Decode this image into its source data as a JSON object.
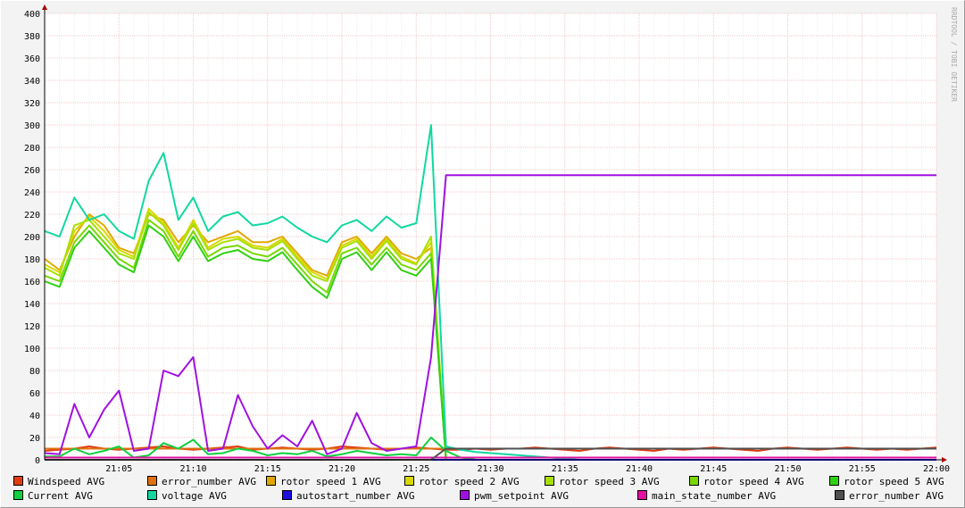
{
  "chart_data": {
    "type": "line",
    "watermark": "RRDTOOL / TOBI OETIKER",
    "ylim": [
      0,
      400
    ],
    "yticks": [
      0,
      20,
      40,
      60,
      80,
      100,
      120,
      140,
      160,
      180,
      200,
      220,
      240,
      260,
      280,
      300,
      320,
      340,
      360,
      380,
      400
    ],
    "x_minutes": [
      0,
      60
    ],
    "xticks": [
      {
        "m": 5,
        "label": "21:05"
      },
      {
        "m": 10,
        "label": "21:10"
      },
      {
        "m": 15,
        "label": "21:15"
      },
      {
        "m": 20,
        "label": "21:20"
      },
      {
        "m": 25,
        "label": "21:25"
      },
      {
        "m": 30,
        "label": "21:30"
      },
      {
        "m": 35,
        "label": "21:35"
      },
      {
        "m": 40,
        "label": "21:40"
      },
      {
        "m": 45,
        "label": "21:45"
      },
      {
        "m": 50,
        "label": "21:50"
      },
      {
        "m": 55,
        "label": "21:55"
      },
      {
        "m": 60,
        "label": "22:00"
      }
    ],
    "series": [
      {
        "name": "Windspeed AVG",
        "color": "#e03c10",
        "values": [
          8,
          9,
          10,
          12,
          10,
          9,
          10,
          11,
          12,
          10,
          9,
          10,
          11,
          12,
          9,
          10,
          11,
          10,
          9,
          10,
          12,
          11,
          10,
          9,
          10,
          11,
          10,
          9,
          9,
          10,
          9,
          10,
          10,
          11,
          10,
          9,
          8,
          10,
          11,
          10,
          9,
          8,
          10,
          9,
          10,
          11,
          10,
          9,
          8,
          10,
          11,
          10,
          9,
          10,
          11,
          10,
          9,
          10,
          9,
          10,
          11
        ]
      },
      {
        "name": "error_number AVG",
        "color": "#e07010",
        "values": [
          10,
          10,
          10,
          10,
          10,
          10,
          10,
          10,
          10,
          10,
          10,
          10,
          10,
          10,
          10,
          10,
          10,
          10,
          10,
          10,
          10,
          10,
          10,
          10,
          10,
          10,
          10,
          10,
          10,
          10,
          10,
          10,
          10,
          10,
          10,
          10,
          10,
          10,
          10,
          10,
          10,
          10,
          10,
          10,
          10,
          10,
          10,
          10,
          10,
          10,
          10,
          10,
          10,
          10,
          10,
          10,
          10,
          10,
          10,
          10,
          10
        ]
      },
      {
        "name": "rotor speed 1 AVG",
        "color": "#e0a800",
        "values": [
          180,
          170,
          200,
          220,
          210,
          190,
          185,
          220,
          215,
          195,
          210,
          195,
          200,
          205,
          195,
          195,
          200,
          185,
          170,
          165,
          195,
          200,
          185,
          200,
          185,
          180,
          190,
          0,
          0,
          0,
          0,
          0,
          0,
          0,
          0,
          0,
          0,
          0,
          0,
          0,
          0,
          0,
          0,
          0,
          0,
          0,
          0,
          0,
          0,
          0,
          0,
          0,
          0,
          0,
          0,
          0,
          0,
          0,
          0,
          0,
          0
        ]
      },
      {
        "name": "rotor speed 2 AVG",
        "color": "#d8d800",
        "values": [
          175,
          168,
          205,
          218,
          205,
          188,
          182,
          225,
          212,
          190,
          215,
          190,
          198,
          200,
          192,
          190,
          198,
          182,
          168,
          162,
          192,
          198,
          182,
          198,
          182,
          176,
          195,
          0,
          0,
          0,
          0,
          0,
          0,
          0,
          0,
          0,
          0,
          0,
          0,
          0,
          0,
          0,
          0,
          0,
          0,
          0,
          0,
          0,
          0,
          0,
          0,
          0,
          0,
          0,
          0,
          0,
          0,
          0,
          0,
          0,
          0
        ]
      },
      {
        "name": "rotor speed 3 AVG",
        "color": "#a8e000",
        "values": [
          172,
          165,
          210,
          215,
          200,
          185,
          180,
          222,
          210,
          188,
          212,
          188,
          195,
          198,
          190,
          188,
          196,
          180,
          165,
          160,
          190,
          196,
          180,
          196,
          180,
          175,
          200,
          0,
          0,
          0,
          0,
          0,
          0,
          0,
          0,
          0,
          0,
          0,
          0,
          0,
          0,
          0,
          0,
          0,
          0,
          0,
          0,
          0,
          0,
          0,
          0,
          0,
          0,
          0,
          0,
          0,
          0,
          0,
          0,
          0,
          0
        ]
      },
      {
        "name": "rotor speed 4 AVG",
        "color": "#78d800",
        "values": [
          165,
          160,
          195,
          210,
          195,
          180,
          172,
          215,
          205,
          182,
          205,
          182,
          190,
          192,
          185,
          182,
          190,
          175,
          160,
          150,
          185,
          190,
          175,
          190,
          175,
          170,
          185,
          0,
          0,
          0,
          0,
          0,
          0,
          0,
          0,
          0,
          0,
          0,
          0,
          0,
          0,
          0,
          0,
          0,
          0,
          0,
          0,
          0,
          0,
          0,
          0,
          0,
          0,
          0,
          0,
          0,
          0,
          0,
          0,
          0,
          0
        ]
      },
      {
        "name": "rotor speed 5 AVG",
        "color": "#30d010",
        "values": [
          160,
          155,
          190,
          205,
          190,
          175,
          168,
          210,
          200,
          178,
          200,
          178,
          185,
          188,
          180,
          178,
          186,
          170,
          155,
          145,
          180,
          186,
          170,
          186,
          170,
          165,
          180,
          0,
          0,
          0,
          0,
          0,
          0,
          0,
          0,
          0,
          0,
          0,
          0,
          0,
          0,
          0,
          0,
          0,
          0,
          0,
          0,
          0,
          0,
          0,
          0,
          0,
          0,
          0,
          0,
          0,
          0,
          0,
          0,
          0,
          0
        ]
      },
      {
        "name": "Current AVG",
        "color": "#10d040",
        "values": [
          3,
          3,
          10,
          5,
          8,
          12,
          2,
          4,
          15,
          10,
          18,
          5,
          6,
          10,
          8,
          4,
          6,
          5,
          8,
          3,
          5,
          8,
          6,
          4,
          5,
          4,
          20,
          8,
          2,
          0,
          0,
          0,
          0,
          0,
          0,
          0,
          0,
          0,
          0,
          0,
          0,
          0,
          0,
          0,
          0,
          0,
          0,
          0,
          0,
          0,
          0,
          0,
          0,
          0,
          0,
          0,
          0,
          0,
          0,
          0,
          0
        ]
      },
      {
        "name": "voltage AVG",
        "color": "#10d8a0",
        "values": [
          205,
          200,
          235,
          215,
          220,
          205,
          198,
          250,
          275,
          215,
          235,
          205,
          218,
          222,
          210,
          212,
          218,
          208,
          200,
          195,
          210,
          215,
          205,
          218,
          208,
          212,
          300,
          12,
          9,
          7,
          6,
          5,
          4,
          3,
          2,
          1,
          0,
          0,
          0,
          0,
          0,
          0,
          0,
          0,
          0,
          0,
          0,
          0,
          0,
          0,
          0,
          0,
          0,
          0,
          0,
          0,
          0,
          0,
          0,
          0,
          0
        ]
      },
      {
        "name": "autostart_number AVG",
        "color": "#2010e0",
        "values": [
          0,
          0,
          0,
          0,
          0,
          0,
          0,
          0,
          0,
          0,
          0,
          0,
          0,
          0,
          0,
          0,
          0,
          0,
          0,
          0,
          0,
          0,
          0,
          0,
          0,
          0,
          0,
          0,
          0,
          0,
          0,
          0,
          0,
          0,
          0,
          0,
          0,
          0,
          0,
          0,
          0,
          0,
          0,
          0,
          0,
          0,
          0,
          0,
          0,
          0,
          0,
          0,
          0,
          0,
          0,
          0,
          0,
          0,
          0,
          0,
          0
        ]
      },
      {
        "name": "pwm_setpoint AVG",
        "color": "#a010e0",
        "values": [
          6,
          5,
          50,
          20,
          45,
          62,
          8,
          10,
          80,
          75,
          92,
          8,
          10,
          58,
          30,
          10,
          22,
          12,
          35,
          5,
          10,
          42,
          15,
          8,
          10,
          12,
          92,
          255,
          255,
          255,
          255,
          255,
          255,
          255,
          255,
          255,
          255,
          255,
          255,
          255,
          255,
          255,
          255,
          255,
          255,
          255,
          255,
          255,
          255,
          255,
          255,
          255,
          255,
          255,
          255,
          255,
          255,
          255,
          255,
          255,
          255
        ]
      },
      {
        "name": "main_state_number AVG",
        "color": "#e010a0",
        "values": [
          2,
          2,
          2,
          2,
          2,
          2,
          2,
          2,
          2,
          2,
          2,
          2,
          2,
          2,
          2,
          2,
          2,
          2,
          2,
          2,
          2,
          2,
          2,
          2,
          2,
          2,
          2,
          2,
          2,
          2,
          2,
          2,
          2,
          2,
          2,
          2,
          2,
          2,
          2,
          2,
          2,
          2,
          2,
          2,
          2,
          2,
          2,
          2,
          2,
          2,
          2,
          2,
          2,
          2,
          2,
          2,
          2,
          2,
          2,
          2,
          2
        ]
      },
      {
        "name": "error_number AVG",
        "color": "#505050",
        "values": [
          0,
          0,
          0,
          0,
          0,
          0,
          0,
          0,
          0,
          0,
          0,
          0,
          0,
          0,
          0,
          0,
          0,
          0,
          0,
          0,
          0,
          0,
          0,
          0,
          0,
          0,
          0,
          10,
          10,
          10,
          10,
          10,
          10,
          10,
          10,
          10,
          10,
          10,
          10,
          10,
          10,
          10,
          10,
          10,
          10,
          10,
          10,
          10,
          10,
          10,
          10,
          10,
          10,
          10,
          10,
          10,
          10,
          10,
          10,
          10,
          10
        ]
      }
    ]
  }
}
